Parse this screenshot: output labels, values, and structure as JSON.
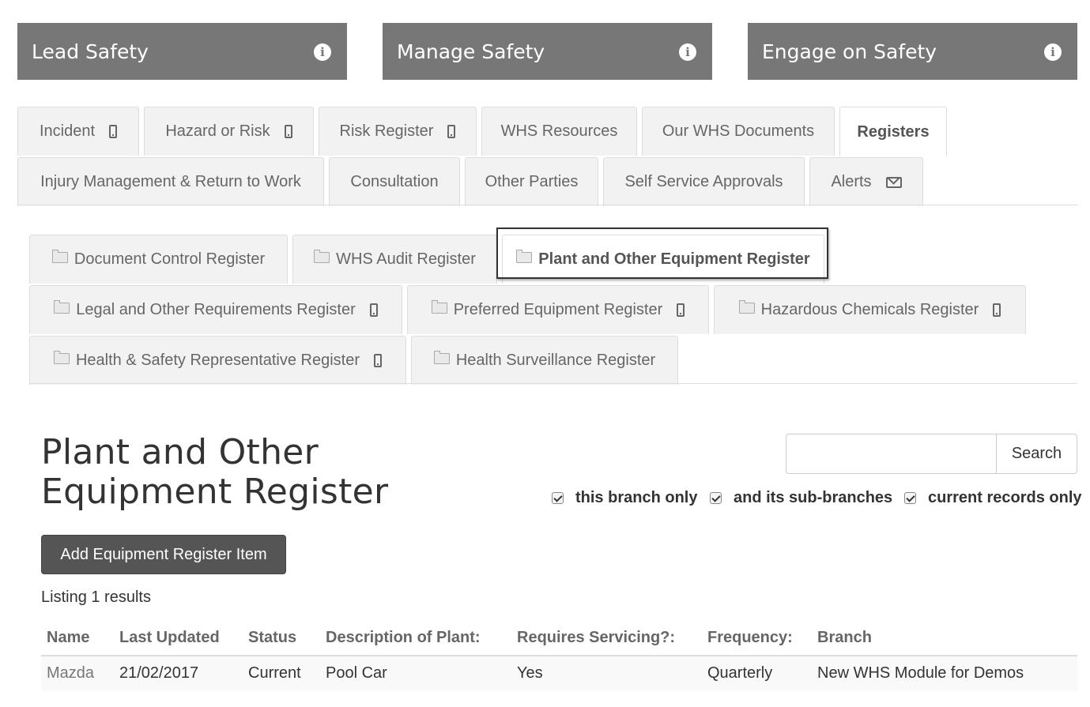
{
  "top_buttons": [
    {
      "label": "Lead Safety"
    },
    {
      "label": "Manage Safety"
    },
    {
      "label": "Engage on Safety"
    }
  ],
  "main_tabs": {
    "incident": "Incident",
    "hazard": "Hazard or Risk",
    "risk_register": "Risk Register",
    "whs_resources": "WHS Resources",
    "our_whs_docs": "Our WHS Documents",
    "registers": "Registers",
    "injury_mgmt": "Injury Management & Return to Work",
    "consultation": "Consultation",
    "other_parties": "Other Parties",
    "self_service": "Self Service Approvals",
    "alerts": "Alerts",
    "active": "Registers"
  },
  "register_tabs": {
    "document_control": "Document Control Register",
    "whs_audit": "WHS Audit Register",
    "plant_equipment": "Plant and Other Equipment Register",
    "legal": "Legal and Other Requirements Register",
    "preferred_equipment": "Preferred Equipment Register",
    "hazardous_chemicals": "Hazardous Chemicals Register",
    "hsr": "Health & Safety Representative Register",
    "health_surveillance": "Health Surveillance Register",
    "active": "Plant and Other Equipment Register"
  },
  "page": {
    "title": "Plant and Other Equipment Register",
    "search_value": "",
    "search_button": "Search",
    "filters": [
      {
        "label": "this branch only",
        "checked": true
      },
      {
        "label": "and its sub-branches",
        "checked": true
      },
      {
        "label": "current records only",
        "checked": true
      }
    ],
    "add_button": "Add Equipment Register Item",
    "listing": "Listing 1 results"
  },
  "table": {
    "columns": [
      "Name",
      "Last Updated",
      "Status",
      "Description of Plant:",
      "Requires Servicing?:",
      "Frequency:",
      "Branch"
    ],
    "rows": [
      [
        "Mazda",
        "21/02/2017",
        "Current",
        "Pool Car",
        "Yes",
        "Quarterly",
        "New WHS Module for Demos"
      ]
    ]
  },
  "colors": {
    "top_button_bg": "#777777",
    "tab_bg": "#f2f2f2",
    "add_button_bg": "#555555"
  }
}
